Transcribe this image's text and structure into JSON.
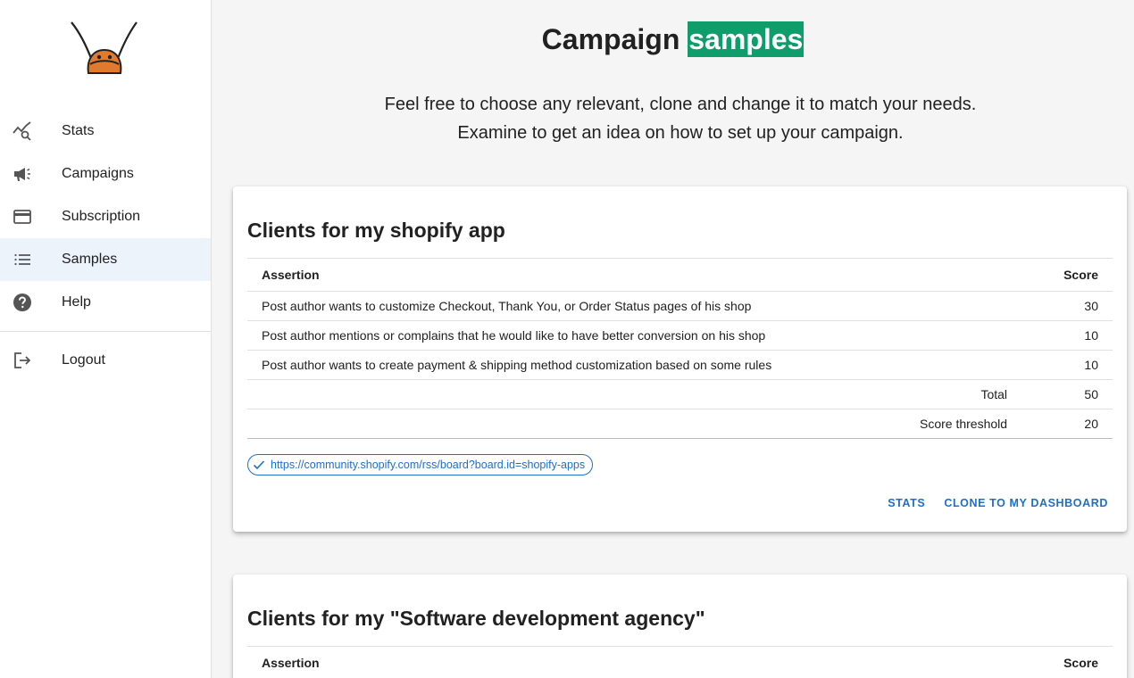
{
  "sidebar": {
    "items": [
      {
        "label": "Stats",
        "icon": "stats-search-icon"
      },
      {
        "label": "Campaigns",
        "icon": "megaphone-icon"
      },
      {
        "label": "Subscription",
        "icon": "credit-card-icon"
      },
      {
        "label": "Samples",
        "icon": "list-icon",
        "active": true
      },
      {
        "label": "Help",
        "icon": "help-circle-icon"
      }
    ],
    "logout_label": "Logout"
  },
  "header": {
    "title_part1": "Campaign ",
    "title_highlight": "samples",
    "subtitle_line1": "Feel free to choose any relevant, clone and change it to match your needs.",
    "subtitle_line2": "Examine to get an idea on how to set up your campaign."
  },
  "cards": [
    {
      "title": "Clients for my shopify app",
      "columns": {
        "assertion": "Assertion",
        "score": "Score"
      },
      "rows": [
        {
          "assertion": "Post author wants to customize Checkout, Thank You, or Order Status pages of his shop",
          "score": "30"
        },
        {
          "assertion": "Post author mentions or complains that he would like to have better conversion on his shop",
          "score": "10"
        },
        {
          "assertion": "Post author wants to create payment & shipping method customization based on some rules",
          "score": "10"
        }
      ],
      "total_label": "Total",
      "total_value": "50",
      "threshold_label": "Score threshold",
      "threshold_value": "20",
      "source_url": "https://community.shopify.com/rss/board?board.id=shopify-apps",
      "stats_label": "STATS",
      "clone_label": "CLONE TO MY DASHBOARD"
    },
    {
      "title": "Clients for my \"Software development agency\"",
      "columns": {
        "assertion": "Assertion",
        "score": "Score"
      }
    }
  ],
  "colors": {
    "accent": "#1f6fc5",
    "highlight": "#0f9d6c",
    "active_nav": "#ecf3fb"
  }
}
